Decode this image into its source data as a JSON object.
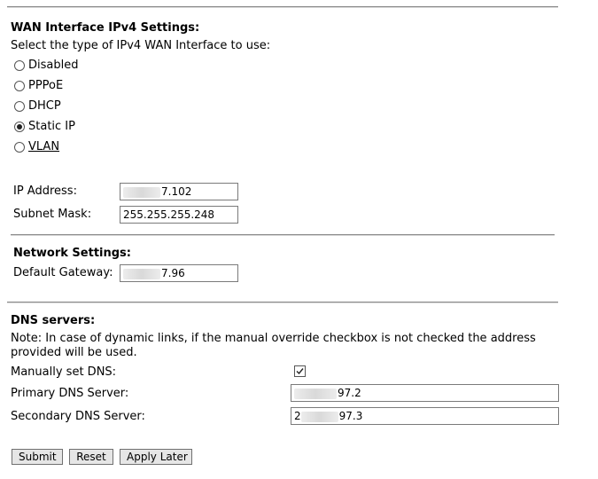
{
  "wan": {
    "title": "WAN Interface IPv4 Settings:",
    "prompt": "Select the type of IPv4 WAN Interface to use:",
    "options": [
      {
        "label": "Disabled",
        "selected": false
      },
      {
        "label": "PPPoE",
        "selected": false
      },
      {
        "label": "DHCP",
        "selected": false
      },
      {
        "label": "Static IP",
        "selected": true
      },
      {
        "label": "VLAN",
        "selected": false
      }
    ]
  },
  "ip": {
    "ip_label": "IP Address:",
    "ip_value_visible": "7.102",
    "mask_label": "Subnet Mask:",
    "mask_value": "255.255.255.248"
  },
  "network": {
    "title": "Network Settings:",
    "gateway_label": "Default Gateway:",
    "gateway_value_visible": "7.96"
  },
  "dns": {
    "title": "DNS servers:",
    "note": "Note: In case of dynamic links, if the manual override checkbox is not checked the address provided will be used.",
    "manual_label": "Manually set DNS:",
    "manual_checked": true,
    "primary_label": "Primary DNS Server:",
    "primary_value_visible": "97.2",
    "secondary_label": "Secondary DNS Server:",
    "secondary_prefix": "2",
    "secondary_value_visible": "97.3"
  },
  "buttons": {
    "submit": "Submit",
    "reset": "Reset",
    "apply_later": "Apply Later"
  }
}
